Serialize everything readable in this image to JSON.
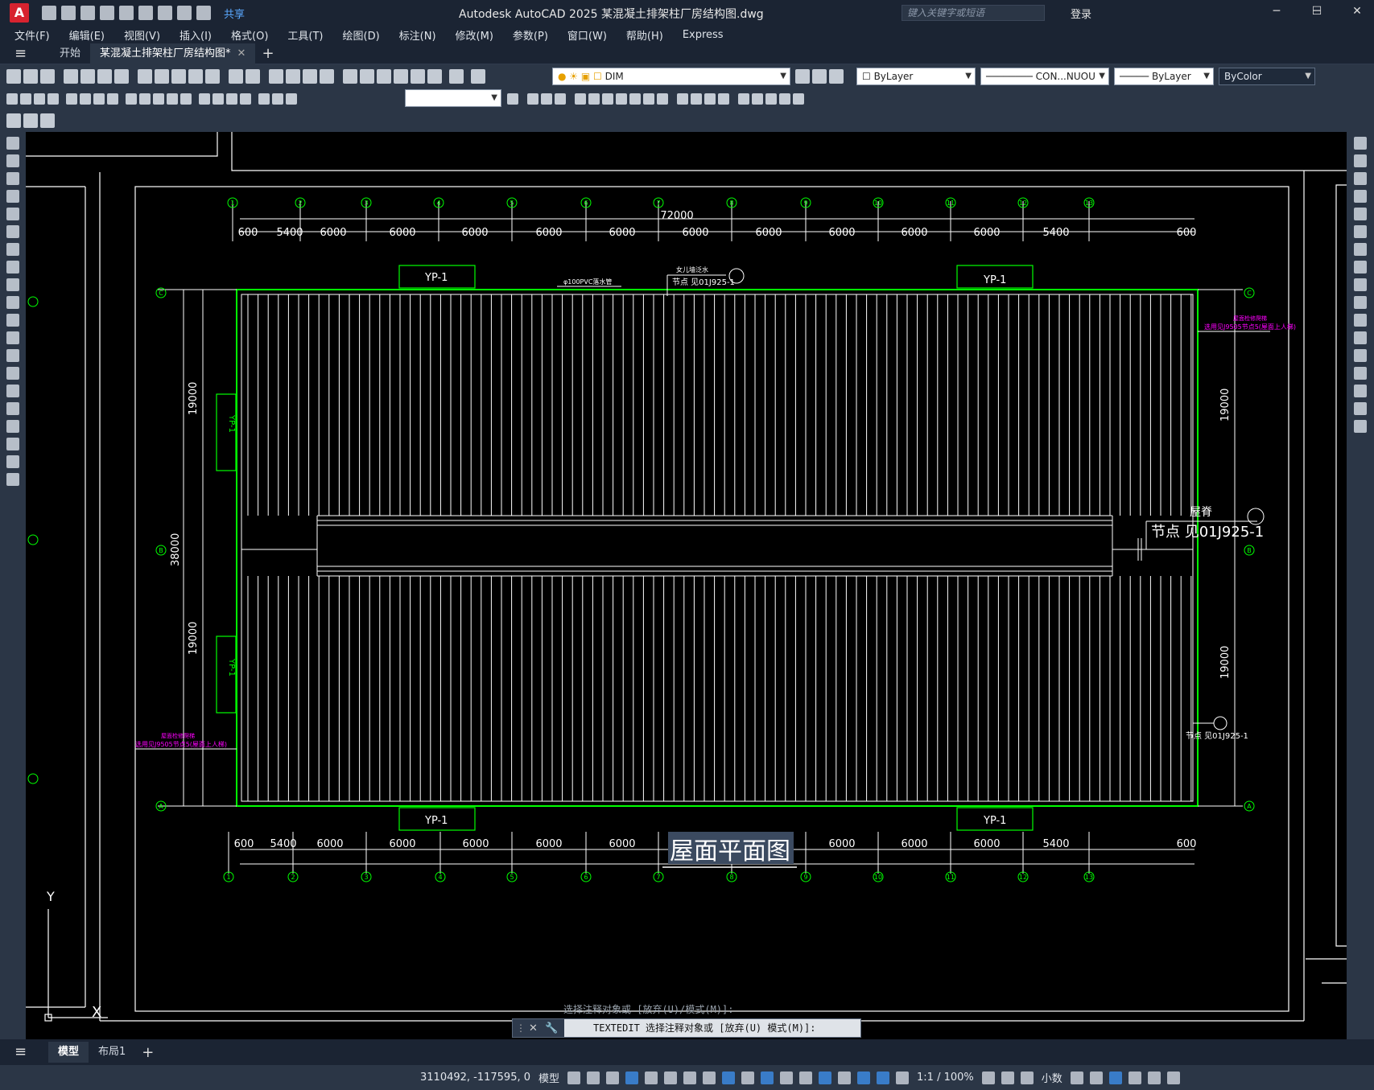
{
  "app": {
    "title": "Autodesk AutoCAD 2025    某混凝土排架柱厂房结构图.dwg",
    "share": "共享",
    "search_placeholder": "键入关键字或短语",
    "login": "登录",
    "logo": "A"
  },
  "menu": [
    "文件(F)",
    "编辑(E)",
    "视图(V)",
    "插入(I)",
    "格式(O)",
    "工具(T)",
    "绘图(D)",
    "标注(N)",
    "修改(M)",
    "参数(P)",
    "窗口(W)",
    "帮助(H)",
    "Express"
  ],
  "tabs": {
    "start": "开始",
    "doc": "某混凝土排架柱厂房结构图*"
  },
  "properties": {
    "layer": "DIM",
    "color": "ByLayer",
    "linetype": "CON...NUOU",
    "lineweight": "ByLayer",
    "plotstyle": "ByColor"
  },
  "drawing": {
    "title": "屋面平面图",
    "total_dim": "72000",
    "top_dims": [
      "600",
      "5400",
      "6000",
      "6000",
      "6000",
      "6000",
      "6000",
      "6000",
      "6000",
      "6000",
      "6000",
      "6000",
      "5400",
      "600"
    ],
    "axis_numbers": [
      "1",
      "2",
      "3",
      "4",
      "5",
      "6",
      "7",
      "8",
      "9",
      "10",
      "11",
      "12",
      "13"
    ],
    "row_axes": [
      "C",
      "B",
      "A"
    ],
    "side_dims": {
      "upper": "19000",
      "lower": "19000",
      "total": "38000"
    },
    "yp": "YP-1",
    "note_pipe": "φ100PVC落水管",
    "note_node_top": "节点 见01J925-1",
    "note_node_top_small": "女儿墙泛水",
    "note_ridge": "屋脊",
    "note_node_ridge": "节点 见01J925-1",
    "note_node_right": "节点 见01J925-1",
    "note_magenta_1": "屋面检修爬梯",
    "note_magenta_2": "选用见J9505节点5(屋面上人梯)",
    "ucs_y": "Y",
    "ucs_x": "X"
  },
  "command": {
    "history": "选择注释对象或 [放弃(U)/模式(M)]:",
    "current": "TEXTEDIT 选择注释对象或 [放弃(U) 模式(M)]:"
  },
  "layout_tabs": {
    "model": "模型",
    "layout1": "布局1"
  },
  "status": {
    "coords": "3110492, -117595, 0",
    "space": "模型",
    "scale": "1:1 / 100%",
    "units": "小数"
  },
  "colors": {
    "accent": "#3d8ee8",
    "line_green": "#00ff00",
    "magenta": "#ff00ff"
  }
}
